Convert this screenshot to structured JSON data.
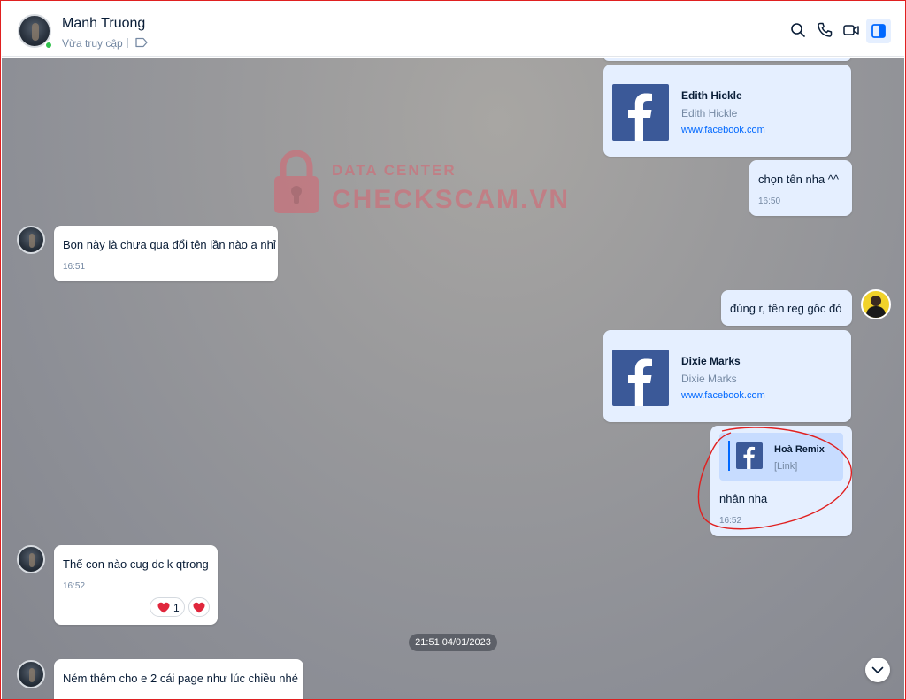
{
  "header": {
    "contact_name": "Manh Truong",
    "status": "Vừa truy cập",
    "icons": [
      "search-icon",
      "phone-icon",
      "video-icon",
      "panel-toggle-icon"
    ]
  },
  "watermark": {
    "line1": "DATA CENTER",
    "line2": "CHECKSCAM.VN"
  },
  "messages": [
    {
      "side": "out",
      "type": "card",
      "title": "Edith Hickle",
      "subtitle": "Edith Hickle",
      "link": "www.facebook.com"
    },
    {
      "side": "out",
      "type": "text",
      "text": "chọn tên nha ^^",
      "time": "16:50"
    },
    {
      "side": "in",
      "type": "text",
      "text": "Bọn này là chưa qua đổi tên lần nào a nhỉ",
      "time": "16:51"
    },
    {
      "side": "out",
      "type": "text",
      "text": "đúng r, tên reg gốc đó"
    },
    {
      "side": "out",
      "type": "card",
      "title": "Dixie Marks",
      "subtitle": "Dixie Marks",
      "link": "www.facebook.com"
    },
    {
      "side": "out",
      "type": "reply",
      "quote_title": "Hoà Remix",
      "quote_sub": "[Link]",
      "text": "nhận nha",
      "time": "16:52"
    },
    {
      "side": "in",
      "type": "text",
      "text": "Thế con nào cug dc k qtrong",
      "time": "16:52",
      "reaction_count": "1"
    },
    {
      "side": "in",
      "type": "text",
      "text": "Ném thêm cho e 2 cái page như lúc chiều nhé"
    }
  ],
  "date_divider": "21:51 04/01/2023",
  "colors": {
    "accent": "#0068ff",
    "outgoing_bubble": "#e5efff",
    "facebook": "#3b5998",
    "annotation": "#e02020"
  }
}
